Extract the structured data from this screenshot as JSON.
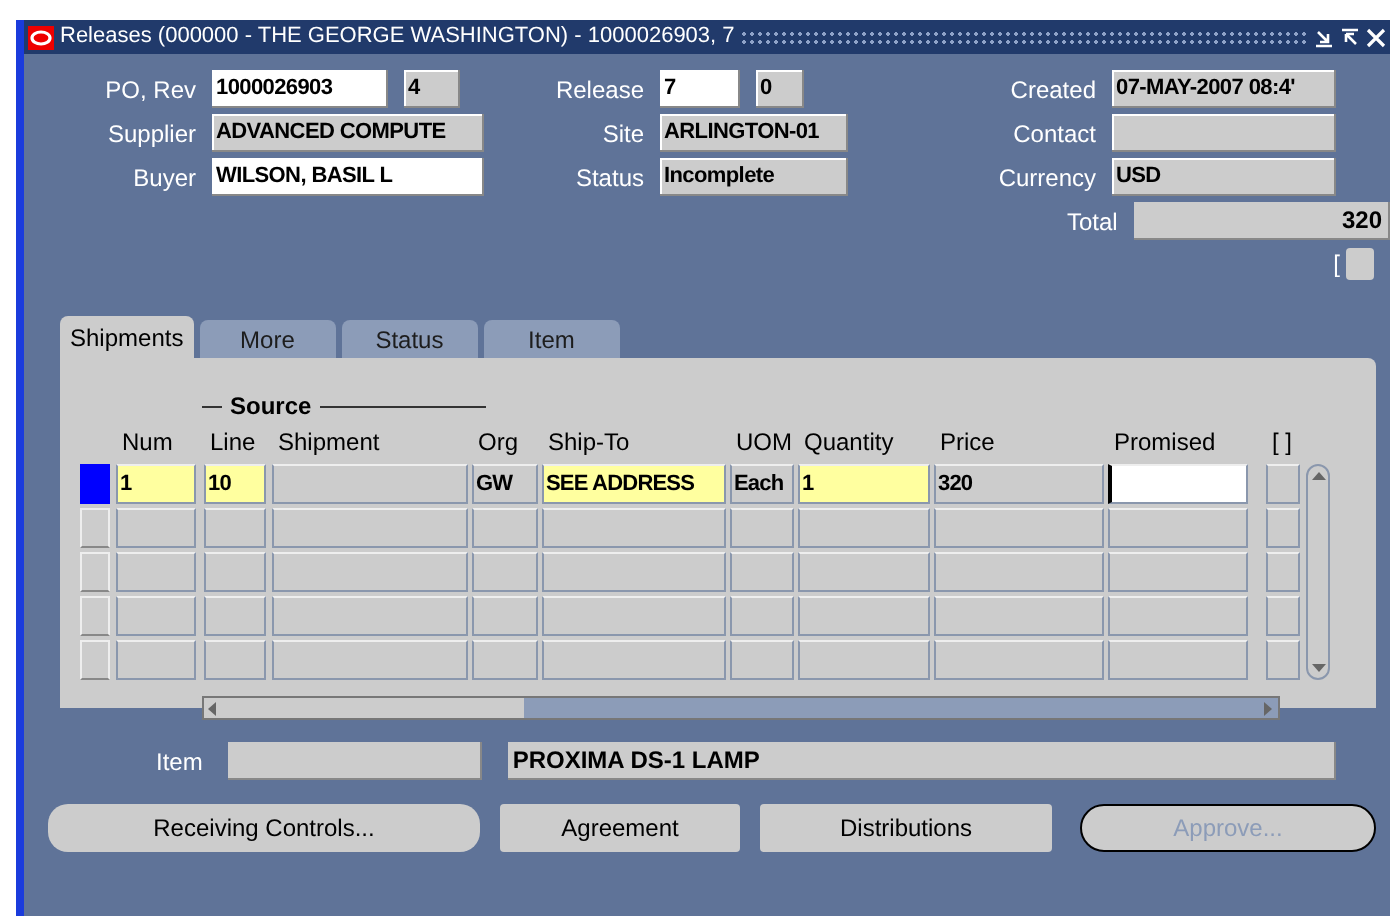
{
  "window": {
    "title": "Releases (000000 - THE GEORGE WASHINGTON) - 1000026903, 7"
  },
  "header": {
    "rows": [
      [
        {
          "label": "PO, Rev",
          "fields": [
            {
              "value": "1000026903",
              "kind": "input"
            },
            {
              "value": "4",
              "kind": "readonly"
            }
          ]
        },
        {
          "label": "Release",
          "fields": [
            {
              "value": "7",
              "kind": "input"
            },
            {
              "value": "0",
              "kind": "readonly"
            }
          ]
        },
        {
          "label": "Created",
          "fields": [
            {
              "value": "07-MAY-2007 08:4'",
              "kind": "readonly"
            }
          ]
        }
      ],
      [
        {
          "label": "Supplier",
          "fields": [
            {
              "value": "ADVANCED COMPUTE",
              "kind": "readonly"
            }
          ]
        },
        {
          "label": "Site",
          "fields": [
            {
              "value": "ARLINGTON-01",
              "kind": "readonly"
            }
          ]
        },
        {
          "label": "Contact",
          "fields": [
            {
              "kind": "readonly"
            }
          ]
        }
      ],
      [
        {
          "label": "Buyer",
          "fields": [
            {
              "value": "WILSON, BASIL L",
              "kind": "input"
            }
          ]
        },
        {
          "label": "Status",
          "fields": [
            {
              "value": "Incomplete",
              "kind": "readonly"
            }
          ]
        },
        {
          "label": "Currency",
          "fields": [
            {
              "value": "USD",
              "kind": "readonly"
            }
          ]
        }
      ]
    ],
    "total": {
      "label": "Total",
      "value": "320"
    },
    "folder_mark": "["
  },
  "tabs": [
    {
      "label": "Shipments",
      "selected": true
    },
    {
      "label": "More",
      "selected": false
    },
    {
      "label": "Status",
      "selected": false
    },
    {
      "label": "Item",
      "selected": false
    }
  ],
  "table": {
    "group": "Source",
    "columns": [
      "Num",
      "Line",
      "Shipment",
      "Org",
      "Ship-To",
      "UOM",
      "Quantity",
      "Price",
      "Promised",
      "[ ]"
    ],
    "rows": [
      {
        "selected": true,
        "cells": [
          {
            "value": "1",
            "kind": "required"
          },
          {
            "value": "10",
            "kind": "required"
          },
          {
            "kind": "readonly"
          },
          {
            "value": "GW",
            "kind": "readonly"
          },
          {
            "value": "SEE ADDRESS",
            "kind": "required"
          },
          {
            "value": "Each",
            "kind": "readonly"
          },
          {
            "value": "1",
            "kind": "required"
          },
          {
            "value": "320",
            "kind": "readonly"
          },
          {
            "kind": "current"
          },
          {
            "kind": "readonly"
          }
        ]
      },
      {
        "selected": false,
        "cells": []
      },
      {
        "selected": false,
        "cells": []
      },
      {
        "selected": false,
        "cells": []
      },
      {
        "selected": false,
        "cells": []
      }
    ]
  },
  "item": {
    "label": "Item",
    "description": "PROXIMA DS-1 LAMP"
  },
  "buttons": [
    {
      "label": "Receiving Controls...",
      "disabled": false
    },
    {
      "label": "Agreement",
      "disabled": false
    },
    {
      "label": "Distributions",
      "disabled": false
    },
    {
      "label": "Approve...",
      "disabled": true
    }
  ]
}
